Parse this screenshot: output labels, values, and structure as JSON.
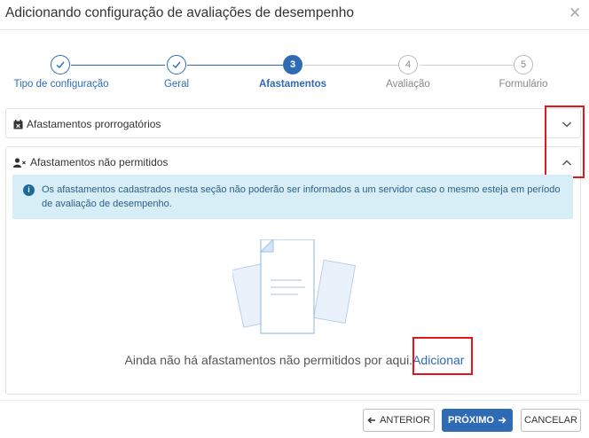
{
  "dialog": {
    "title": "Adicionando configuração de avaliações de desempenho",
    "close_icon": "close-icon"
  },
  "stepper": {
    "steps": [
      {
        "number": "1",
        "label": "Tipo de configuração",
        "state": "done"
      },
      {
        "number": "2",
        "label": "Geral",
        "state": "done"
      },
      {
        "number": "3",
        "label": "Afastamentos",
        "state": "active"
      },
      {
        "number": "4",
        "label": "Avaliação",
        "state": "todo"
      },
      {
        "number": "5",
        "label": "Formulário",
        "state": "todo"
      }
    ]
  },
  "panels": {
    "prorrogatorios": {
      "title": "Afastamentos prorrogatórios",
      "icon": "calendar-x-icon",
      "expanded": false
    },
    "nao_permitidos": {
      "title": "Afastamentos não permitidos",
      "icon": "user-x-icon",
      "expanded": true
    }
  },
  "alert": {
    "icon": "info-icon",
    "text": "Os afastamentos cadastrados nesta seção não poderão ser informados a um servidor caso o mesmo esteja em período de avaliação de desempenho."
  },
  "empty_state": {
    "message": "Ainda não há afastamentos não permitidos por aqui.",
    "link": "Adicionar"
  },
  "footer": {
    "previous": "ANTERIOR",
    "next": "PRÓXIMO",
    "cancel": "CANCELAR"
  },
  "colors": {
    "primary": "#2f6bb5",
    "alert_bg": "#d7eef6",
    "alert_text": "#2b5f87",
    "highlight": "#e3161b"
  }
}
